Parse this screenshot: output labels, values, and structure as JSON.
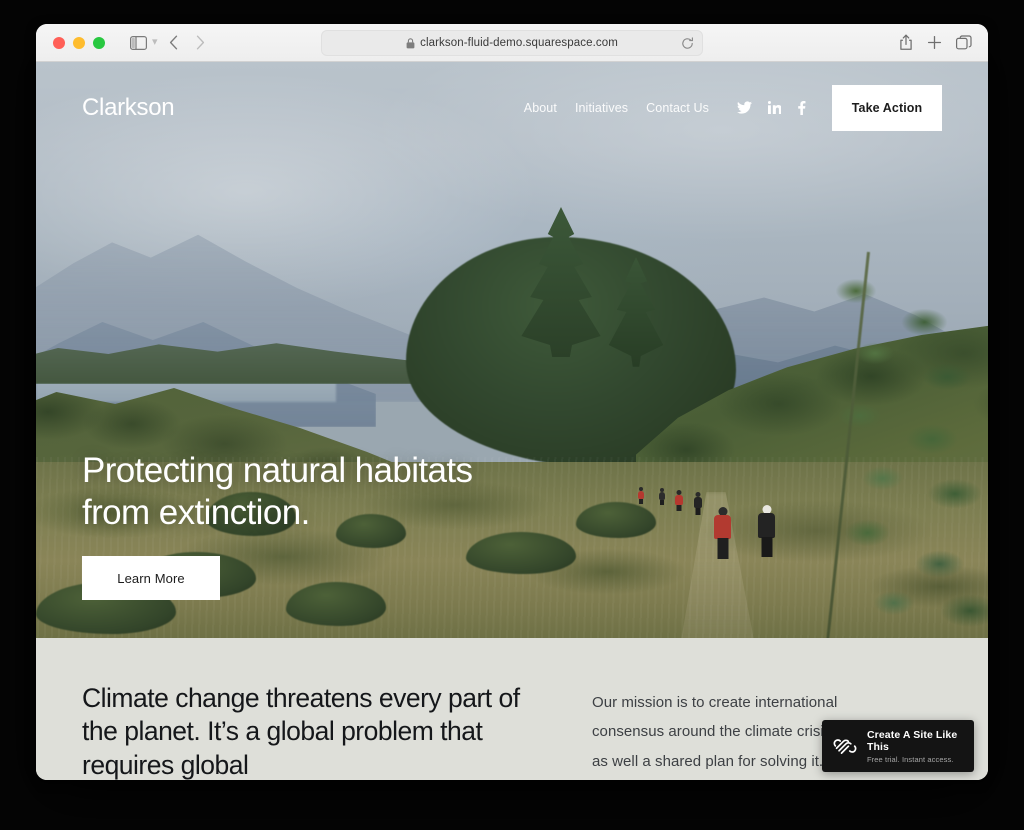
{
  "browser": {
    "url": "clarkson-fluid-demo.squarespace.com",
    "lock_icon": "lock-icon",
    "reload_icon": "reload-icon",
    "back_icon": "back-arrow-icon",
    "forward_icon": "forward-arrow-icon",
    "sidebar_icon": "sidebar-toggle-icon",
    "sidebar_chevron_icon": "chevron-down-icon",
    "share_icon": "share-icon",
    "new_tab_icon": "plus-icon",
    "tab_overview_icon": "tabs-overview-icon",
    "traffic_lights": {
      "close": "#ff5f57",
      "minimize": "#febc2e",
      "maximize": "#28c840"
    }
  },
  "site": {
    "logo": "Clarkson",
    "nav": [
      {
        "label": "About"
      },
      {
        "label": "Initiatives"
      },
      {
        "label": "Contact Us"
      }
    ],
    "social": [
      {
        "name": "twitter-icon"
      },
      {
        "name": "linkedin-icon"
      },
      {
        "name": "facebook-icon"
      }
    ],
    "cta_button": "Take Action",
    "hero": {
      "heading": "Protecting natural habitats\nfrom extinction.",
      "button": "Learn More"
    },
    "section": {
      "heading": "Climate change threatens every part of the planet. It’s a global problem that requires global",
      "body": "Our mission is to create international\nconsensus around the climate crisis,\nas well a shared plan for solving it."
    },
    "colors": {
      "section_background": "#dedfd9",
      "button_background": "#ffffff",
      "heading_text": "#15171a",
      "hero_text": "#ffffff"
    }
  },
  "promo": {
    "logo_icon": "squarespace-logo-icon",
    "title": "Create A Site Like This",
    "subtitle": "Free trial. Instant access."
  }
}
